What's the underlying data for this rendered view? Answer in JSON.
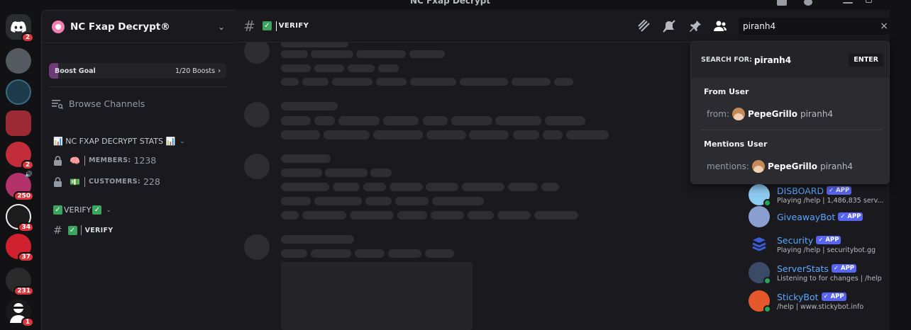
{
  "window": {
    "title": "NC Fxap Decrypt"
  },
  "rail": {
    "servers": [
      {
        "name": "home",
        "badge": "2",
        "color": "#2b2d31"
      },
      {
        "name": "server-skull",
        "badge": "",
        "color": "#555a60"
      },
      {
        "name": "server-blue-orb",
        "badge": "",
        "color": "#1e3b4c"
      },
      {
        "name": "server-red-1",
        "badge": "",
        "color": "#9b2a35"
      },
      {
        "name": "server-red-2",
        "badge": "2",
        "color": "#c22c3b"
      },
      {
        "name": "server-pink",
        "badge": "250",
        "color": "#b4326a"
      },
      {
        "name": "server-bunny",
        "badge": "34",
        "color": "#1c1c1c"
      },
      {
        "name": "server-red-swirl",
        "badge": "37",
        "color": "#d1212e"
      },
      {
        "name": "server-grey-logo",
        "badge": "231",
        "color": "#2a2a2a"
      },
      {
        "name": "server-agent",
        "badge": "1",
        "color": "#1a1a1a"
      }
    ]
  },
  "server": {
    "name": "NC Fxap Decrypt®"
  },
  "boost": {
    "goal_label": "Boost Goal",
    "count": "1/20 Boosts",
    "progress": 0.05
  },
  "browse": {
    "label": "Browse Channels"
  },
  "categories": [
    {
      "label": "📊 NC FXAP DECRYPT STATS 📊"
    },
    {
      "label": "VERIFY"
    }
  ],
  "channels": {
    "members": {
      "emoji": "🧠",
      "label": "MEMBERS:",
      "value": "1238"
    },
    "customers": {
      "emoji": "💵",
      "label": "CUSTOMERS:",
      "value": "228"
    },
    "verify": {
      "label": "VERIFY"
    }
  },
  "header": {
    "channel_name": "VERIFY"
  },
  "search": {
    "value": "piranh4",
    "search_for_label": "SEARCH FOR:",
    "query": "piranh4",
    "enter_label": "ENTER",
    "from_section": "From User",
    "from_prefix": "from:",
    "mentions_section": "Mentions User",
    "mentions_prefix": "mentions:",
    "user_display": "PepeGrillo",
    "user_tag": "piranh4"
  },
  "members": [
    {
      "name": "DISBOARD",
      "badge": "✓ APP",
      "status": "Playing /help | 1,486,835 serv...",
      "color": "#8ecbf2"
    },
    {
      "name": "GiveawayBot",
      "badge": "✓ APP",
      "status": "",
      "color": "#8a9fd0"
    },
    {
      "name": "Security",
      "badge": "✓ APP",
      "status": "Playing /help | securitybot.gg",
      "color": "#2f4db8"
    },
    {
      "name": "ServerStats",
      "badge": "✓ APP",
      "status": "Listening to for changes | /help",
      "color": "#3b4a66"
    },
    {
      "name": "StickyBot",
      "badge": "✓ APP",
      "status": "/help | www.stickybot.info",
      "color": "#e6582b"
    }
  ]
}
